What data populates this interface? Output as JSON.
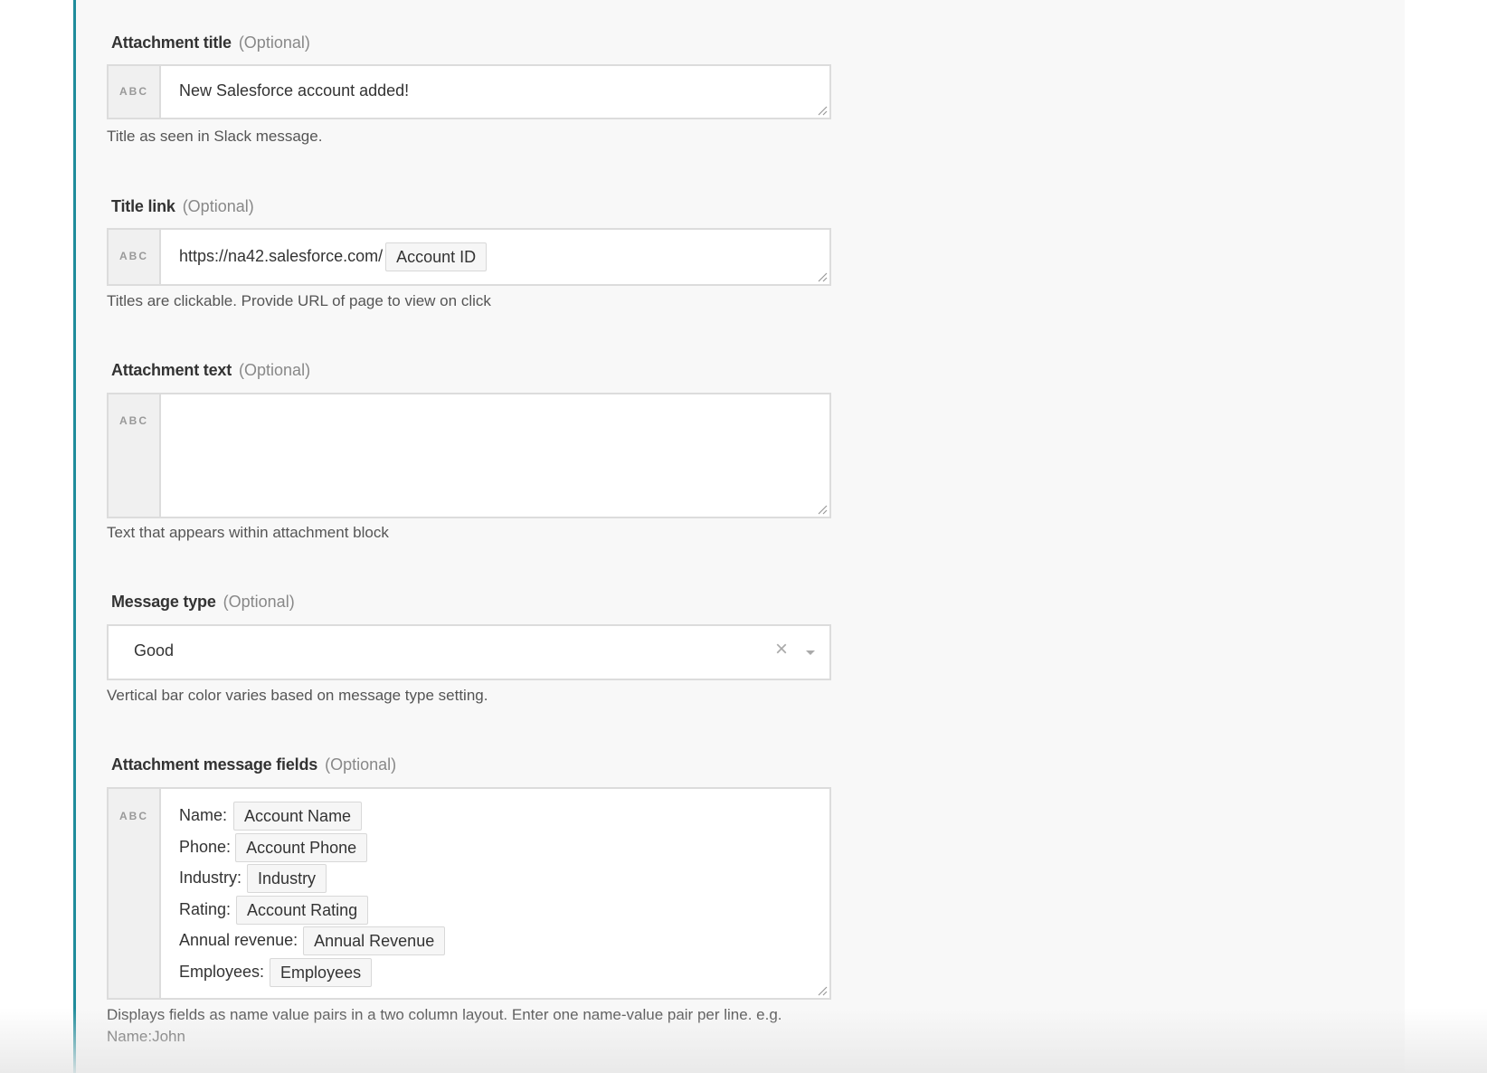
{
  "fields": {
    "attachment_title": {
      "label": "Attachment title",
      "optional": "(Optional)",
      "type_tag": "ABC",
      "value": "New Salesforce account added!",
      "help": "Title as seen in Slack message."
    },
    "title_link": {
      "label": "Title link",
      "optional": "(Optional)",
      "type_tag": "ABC",
      "value_prefix": "https://na42.salesforce.com/",
      "value_pill": "Account ID",
      "help": "Titles are clickable. Provide URL of page to view on click"
    },
    "attachment_text": {
      "label": "Attachment text",
      "optional": "(Optional)",
      "type_tag": "ABC",
      "value": "",
      "help": "Text that appears within attachment block"
    },
    "message_type": {
      "label": "Message type",
      "optional": "(Optional)",
      "selected": "Good",
      "clear_glyph": "×",
      "help": "Vertical bar color varies based on message type setting."
    },
    "attachment_message_fields": {
      "label": "Attachment message fields",
      "optional": "(Optional)",
      "type_tag": "ABC",
      "lines": [
        {
          "name": "Name:",
          "pill": "Account Name"
        },
        {
          "name": "Phone:",
          "pill": "Account Phone"
        },
        {
          "name": "Industry:",
          "pill": "Industry"
        },
        {
          "name": "Rating:",
          "pill": "Account Rating"
        },
        {
          "name": "Annual revenue:",
          "pill": "Annual Revenue"
        },
        {
          "name": "Employees:",
          "pill": "Employees"
        }
      ],
      "help_line1": "Displays fields as name value pairs in a two column layout. Enter one name-value pair per line. e.g.",
      "help_line2": "Name:John"
    }
  },
  "colors": {
    "panel_accent": "#1f8c9b",
    "panel_background": "#f8f8f8",
    "input_border": "#dcdcdc"
  }
}
